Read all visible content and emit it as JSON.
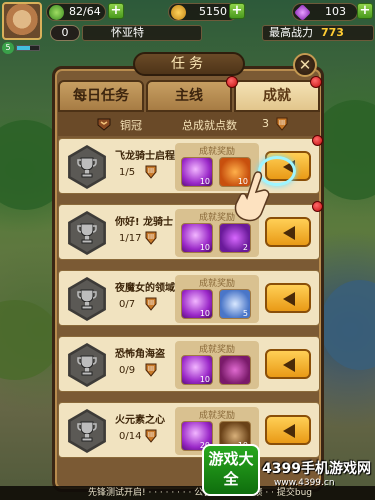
{
  "hud": {
    "stamina": "82/64",
    "gold": "5150",
    "gems": "103",
    "level": "0",
    "player_name": "怀亚特",
    "power_label": "最高战力",
    "power_value": "773",
    "small_level": "5"
  },
  "panel": {
    "title": "任务",
    "close_icon": "close-icon",
    "tabs": [
      {
        "label": "每日任务",
        "active": false
      },
      {
        "label": "主线",
        "active": false
      },
      {
        "label": "成就",
        "active": true
      }
    ],
    "rank_label": "铜冠",
    "total_label": "总成就点数",
    "total_value": "3"
  },
  "rewards_label": "成就奖励",
  "achievements": [
    {
      "name": "飞龙骑士启程",
      "progress": "1/5",
      "reward_counts": [
        "10",
        "10"
      ],
      "reward_icons": [
        "gem-icon",
        "wings-icon"
      ],
      "has_dot": true
    },
    {
      "name": "你好! 龙骑士",
      "progress": "1/17",
      "reward_counts": [
        "10",
        "2"
      ],
      "reward_icons": [
        "gem-icon",
        "potion-icon"
      ],
      "has_dot": true
    },
    {
      "name": "夜魔女的领域",
      "progress": "0/7",
      "reward_counts": [
        "10",
        "5"
      ],
      "reward_icons": [
        "gem-icon",
        "orb-icon"
      ],
      "has_dot": false
    },
    {
      "name": "恐怖角海盗",
      "progress": "0/9",
      "reward_counts": [
        "10",
        ""
      ],
      "reward_icons": [
        "gem-icon",
        "creature-icon"
      ],
      "has_dot": false
    },
    {
      "name": "火元素之心",
      "progress": "0/14",
      "reward_counts": [
        "20",
        "10"
      ],
      "reward_icons": [
        "gem-icon",
        "card-icon"
      ],
      "has_dot": false
    }
  ],
  "footer": {
    "text": "先锋测试开启! · · · · · · · · 公告 · · 问卷反馈 · · 提交bug",
    "logo_left": "游戏大全",
    "logo_right": "4399手机游戏网",
    "logo_url": "www.4399.cn"
  },
  "colors": {
    "accent_gold": "#ffcc33",
    "tab_active": "#f4e1b4",
    "notification_red": "#c40d0d"
  }
}
